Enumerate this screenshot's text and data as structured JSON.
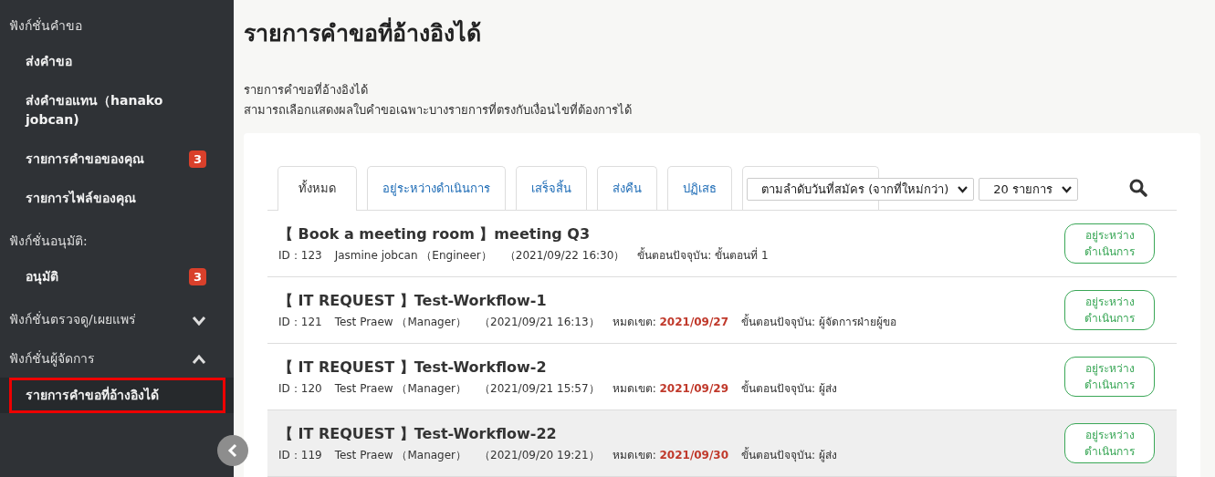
{
  "sidebar": {
    "sections": [
      {
        "title": "ฟังก์ชั่นคำขอ",
        "items": [
          {
            "label": "ส่งคำขอ",
            "selected": false
          },
          {
            "label": "ส่งคำขอแทน（hanako jobcan)",
            "selected": false
          },
          {
            "label": "รายการคำขอของคุณ",
            "badge": "3",
            "selected": false
          },
          {
            "label": "รายการไฟล์ของคุณ",
            "selected": false
          }
        ]
      },
      {
        "title": "ฟังก์ชั่นอนุมัติ:",
        "items": [
          {
            "label": "อนุมัติ",
            "badge": "3",
            "selected": false
          }
        ]
      },
      {
        "title": "ฟังก์ชั่นตรวจดู/เผยแพร่",
        "expanded": false
      },
      {
        "title": "ฟังก์ชั่นผู้จัดการ",
        "expanded": true,
        "items": [
          {
            "label": "รายการคำขอที่อ้างอิงได้",
            "selected": true
          }
        ]
      }
    ]
  },
  "page": {
    "title": "รายการคำขอที่อ้างอิงได้",
    "description": [
      "รายการคำขอที่อ้างอิงได้",
      "สามารถเลือกแสดงผลใบคำขอเฉพาะบางรายการที่ตรงกับเงื่อนไขที่ต้องการได้"
    ]
  },
  "tabs": [
    {
      "label": "ทั้งหมด",
      "selected": true
    },
    {
      "label": "อยู่ระหว่างดำเนินการ",
      "selected": false
    },
    {
      "label": "เสร็จสิ้น",
      "selected": false
    },
    {
      "label": "ส่งคืน",
      "selected": false
    },
    {
      "label": "ปฏิเสธ",
      "selected": false
    }
  ],
  "sort_select": {
    "value": "ตามลำดับวันที่สมัคร (จากที่ใหม่กว่า)"
  },
  "count_select": {
    "value": "20 รายการ"
  },
  "requests": [
    {
      "title": "【 Book a meeting room 】meeting Q3",
      "id": "ID：123",
      "applicant": "Jasmine jobcan （Engineer）",
      "date": "（2021/09/22 16:30）",
      "step_label": "ขั้นตอนปัจจุบัน:",
      "step": "ขั้นตอนที่ 1",
      "status": "อยู่ระหว่างดำเนินการ",
      "hovered": false
    },
    {
      "title": "【 IT REQUEST 】Test-Workflow-1",
      "id": "ID：121",
      "applicant": "Test Praew （Manager）",
      "date": "（2021/09/21 16:13）",
      "deadline_label": "หมดเขต:",
      "deadline": "2021/09/27",
      "step_label": "ขั้นตอนปัจจุบัน:",
      "step": "ผู้จัดการฝ่ายผู้ขอ",
      "status": "อยู่ระหว่างดำเนินการ",
      "hovered": false
    },
    {
      "title": "【 IT REQUEST 】Test-Workflow-2",
      "id": "ID：120",
      "applicant": "Test Praew （Manager）",
      "date": "（2021/09/21 15:57）",
      "deadline_label": "หมดเขต:",
      "deadline": "2021/09/29",
      "step_label": "ขั้นตอนปัจจุบัน:",
      "step": "ผู้ส่ง",
      "status": "อยู่ระหว่างดำเนินการ",
      "hovered": false
    },
    {
      "title": "【 IT REQUEST 】Test-Workflow-22",
      "id": "ID：119",
      "applicant": "Test Praew （Manager）",
      "date": "（2021/09/20 19:21）",
      "deadline_label": "หมดเขต:",
      "deadline": "2021/09/30",
      "step_label": "ขั้นตอนปัจจุบัน:",
      "step": "ผู้ส่ง",
      "status": "อยู่ระหว่างดำเนินการ",
      "hovered": true
    }
  ]
}
